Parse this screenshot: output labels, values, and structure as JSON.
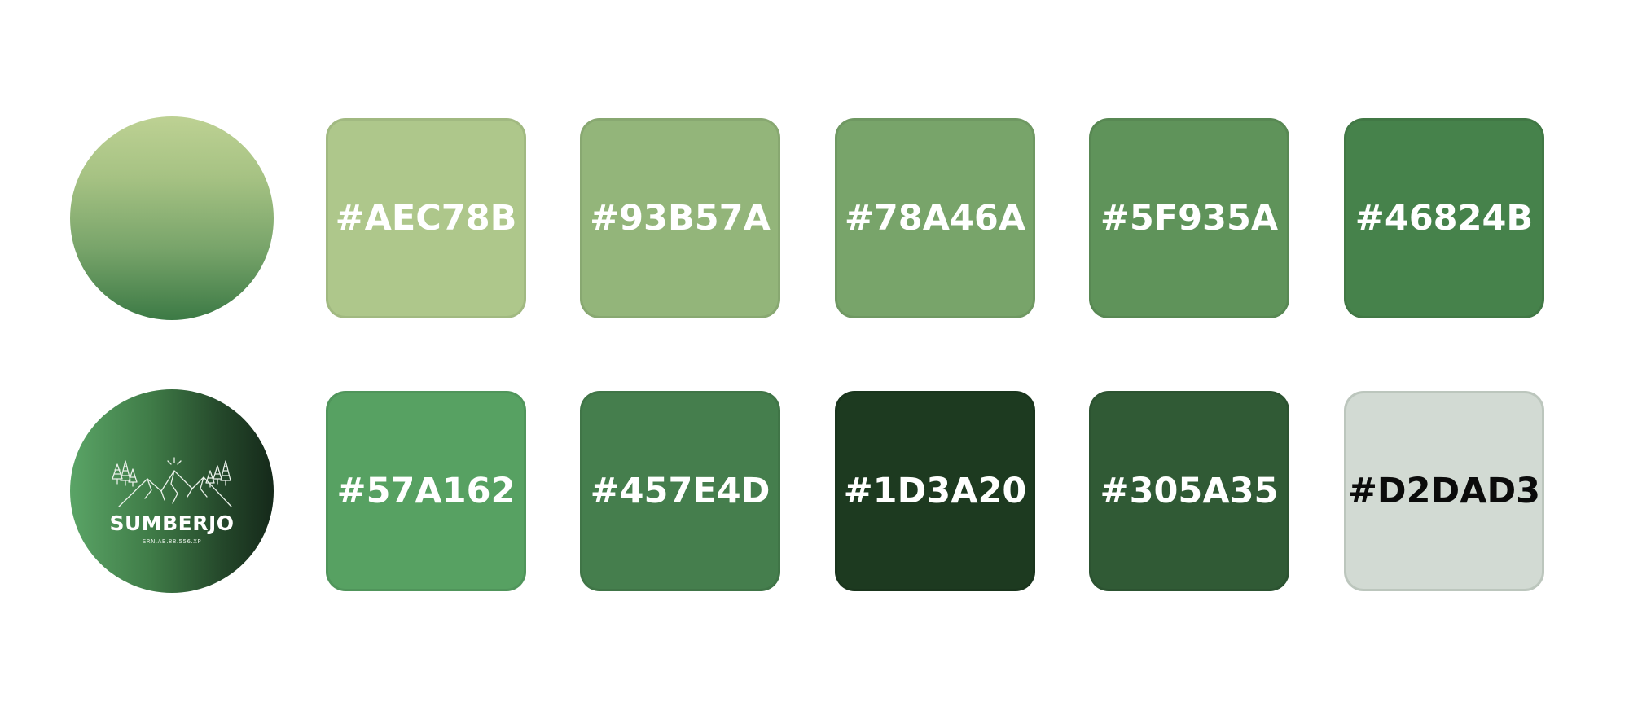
{
  "palette": {
    "row1": [
      {
        "label": "#AEC78B",
        "color": "#AEC78B"
      },
      {
        "label": "#93B57A",
        "color": "#93B57A"
      },
      {
        "label": "#78A46A",
        "color": "#78A46A"
      },
      {
        "label": "#5F935A",
        "color": "#5F935A"
      },
      {
        "label": "#46824B",
        "color": "#46824B"
      }
    ],
    "row2": [
      {
        "label": "#57A162",
        "color": "#57A162"
      },
      {
        "label": "#457E4D",
        "color": "#457E4D"
      },
      {
        "label": "#1D3A20",
        "color": "#1D3A20"
      },
      {
        "label": "#305A35",
        "color": "#305A35"
      },
      {
        "label": "#D2DAD3",
        "color": "#D2DAD3"
      }
    ]
  },
  "logo": {
    "name": "SUMBERJO",
    "subtitle": "SRN.AB.88.556.XP",
    "icon": "mountain-pine-trees-icon"
  }
}
